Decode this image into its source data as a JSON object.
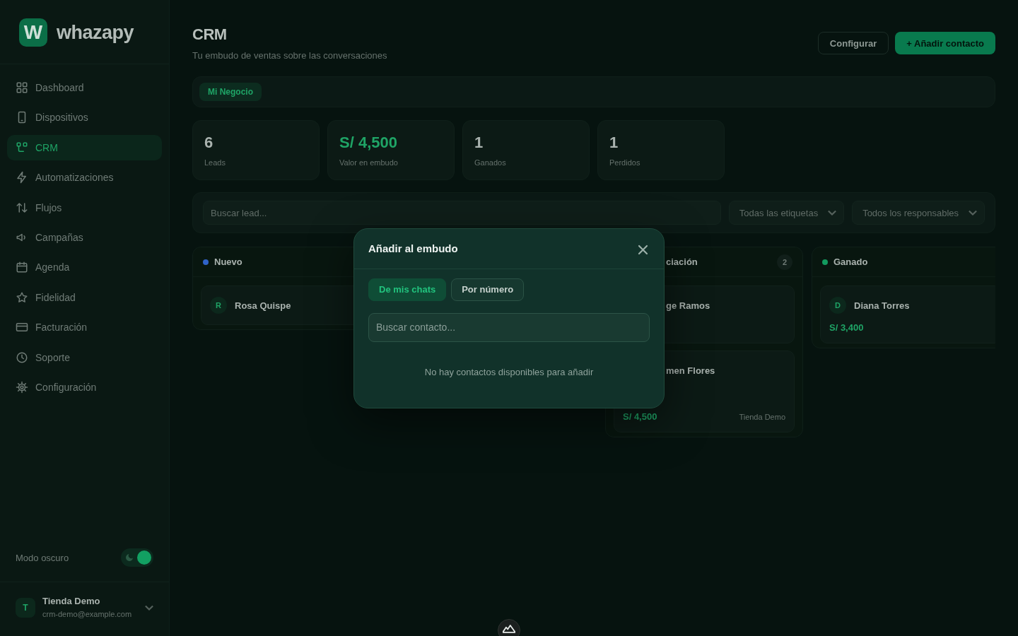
{
  "sidebar": {
    "logo": {
      "mark": "W",
      "name": "whazapy"
    },
    "items": [
      {
        "label": "Dashboard",
        "selected": false
      },
      {
        "label": "Dispositivos",
        "selected": false
      },
      {
        "label": "CRM",
        "selected": true
      },
      {
        "label": "Automatizaciones",
        "selected": false
      },
      {
        "label": "Flujos",
        "selected": false
      },
      {
        "label": "Campañas",
        "selected": false
      },
      {
        "label": "Agenda",
        "selected": false
      },
      {
        "label": "Fidelidad",
        "selected": false
      },
      {
        "label": "Facturación",
        "selected": false
      },
      {
        "label": "Soporte",
        "selected": false
      },
      {
        "label": "Configuración",
        "selected": false
      }
    ],
    "dark_mode": {
      "label": "Modo oscuro",
      "on": true
    },
    "account": {
      "avatar": "T",
      "name": "Tienda Demo",
      "email": "crm-demo@example.com"
    }
  },
  "header": {
    "title": "CRM",
    "subtitle": "Tu embudo de ventas sobre las conversaciones",
    "buttons": [
      {
        "label": "Configurar",
        "kind": "secondary"
      },
      {
        "label": "+ Añadir contacto",
        "kind": "primary"
      }
    ]
  },
  "pipelines": [
    {
      "label": "Mi Negocio",
      "selected": true
    }
  ],
  "stats": [
    {
      "value": "6",
      "label": "Leads",
      "kind": "count"
    },
    {
      "value": "S/ 4,500",
      "label": "Valor en embudo",
      "kind": "currency"
    },
    {
      "value": "1",
      "label": "Ganados",
      "kind": "count"
    },
    {
      "value": "1",
      "label": "Perdidos",
      "kind": "count"
    }
  ],
  "filters": {
    "search": {
      "placeholder": "Buscar lead..."
    },
    "selects": [
      {
        "value": "Todas las etiquetas"
      },
      {
        "value": "Todos los responsables"
      }
    ]
  },
  "board": {
    "columns": [
      {
        "title": "Nuevo",
        "color": "#2f62c8",
        "cards": [
          {
            "avatar": "R",
            "name": "Rosa Quispe"
          }
        ]
      },
      {
        "title": "ciación",
        "count": "2",
        "cards": [
          {
            "name": "ge Ramos"
          },
          {
            "name": "men Flores",
            "value": "S/ 4,500",
            "owner": "Tienda Demo"
          }
        ]
      },
      {
        "title": "Ganado",
        "color": "#129a5e",
        "cards": [
          {
            "avatar": "D",
            "name": "Diana Torres",
            "value": "S/ 3,400"
          }
        ]
      }
    ]
  },
  "dialog": {
    "title": "Añadir al embudo",
    "tabs": [
      {
        "label": "De mis chats",
        "selected": true
      },
      {
        "label": "Por número",
        "selected": false
      }
    ],
    "search": {
      "placeholder": "Buscar contacto..."
    },
    "empty_message": "No hay contactos disponibles para añadir"
  }
}
